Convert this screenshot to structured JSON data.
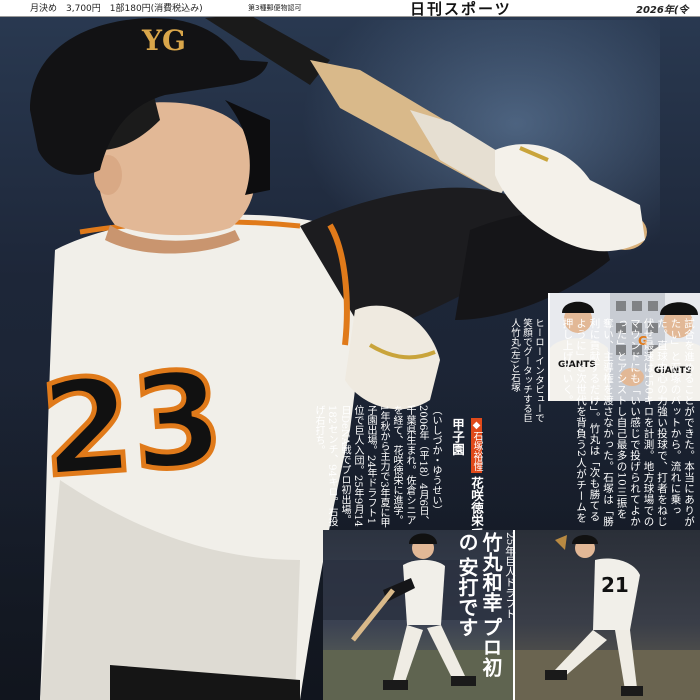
{
  "masthead": {
    "price": "月決め　3,700円　1部180円(消費税込み)",
    "permit": "第3種郵便物認可",
    "logo": "日刊スポーツ",
    "date": "2026年(令"
  },
  "player": {
    "helmet_logo": "YG",
    "number": "23"
  },
  "article": {
    "body": "試合を進めることができた。本当にありがたい」と石塚のバットから。流れに乗った。直球中心の力強い投球で、打者をねじ伏せ最速は150キロを計測。地方球場でのマウンドにも「いい感じで投げられてよかった」とアシストし自己最多の10三振を奪い、主導権を渡さなかった。石塚は「勝利に貢献するだけ」。竹丸は「次も勝てるように」と次世代を背負う2人がチームを押し上げていく。"
  },
  "photo1": {
    "caption": "ヒーローインタビューで笑顔でグータッチする巨人竹丸(左)と石塚",
    "jersey_left": "GIANTS",
    "jersey_right": "GIANTS",
    "board_label": "G"
  },
  "profile": {
    "tag": "◆石塚裕惺",
    "name": "花咲徳栄で甲子園",
    "reading": "（いしづか・ゆうせい）2006年（平18）4月6日、千葉県生まれ。佐倉シニアを経て、花咲徳栄に進学。1年秋から主力で3年夏に甲子園出場。24年ドラフト1位で巨人入団。25年9月14日DeNA戦でプロ初出場。182センチ、94キロ。右投げ右打ち。"
  },
  "headline": {
    "kicker": "25年巨人ドラフト",
    "line1": "竹丸和幸",
    "line2": "プロ初の",
    "line3": "安打です"
  },
  "photo3": {
    "number": "21"
  }
}
